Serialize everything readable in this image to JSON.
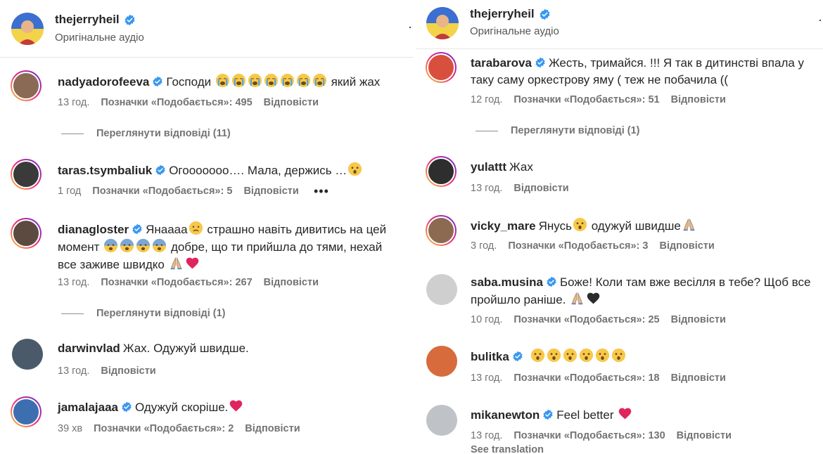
{
  "left": {
    "header": {
      "username": "thejerryheil",
      "subtitle": "Оригінальне аудіо"
    },
    "comments": [
      {
        "user": "nadyadorofeeva",
        "text": "Господи",
        "emoji_after": "😭😭😭😭😭😭😭",
        "text2": "який жах",
        "time": "13 год.",
        "likes": "Позначки «Подобається»: 495",
        "reply": "Відповісти",
        "view_replies": "Переглянути відповіді (11)"
      },
      {
        "user": "taras.tsymbaliuk",
        "text": "Огооооооо…. Мала, держись …",
        "emoji_after": "😮",
        "time": "1 год",
        "likes": "Позначки «Подобається»: 5",
        "reply": "Відповісти",
        "more": "•••"
      },
      {
        "user": "dianagloster",
        "line1": "Янаааа",
        "line1b": "страшно навіть дивитись на цей",
        "line2a": "момент",
        "line2b": "добре, що ти прийшла до тями, нехай",
        "line3": "все заживе швидко",
        "time": "13 год.",
        "likes": "Позначки «Подобається»: 267",
        "reply": "Відповісти",
        "view_replies": "Переглянути відповіді (1)"
      },
      {
        "user": "darwinvlad",
        "text": "Жах. Одужуй швидше.",
        "time": "13 год.",
        "reply": "Відповісти"
      },
      {
        "user": "jamalajaaa",
        "text": "Одужуй скоріше.",
        "time": "39 хв",
        "likes": "Позначки «Подобається»: 2",
        "reply": "Відповісти"
      }
    ]
  },
  "right": {
    "header": {
      "username": "thejerryheil",
      "subtitle": "Оригінальне аудіо"
    },
    "comments": [
      {
        "user": "tarabarova",
        "line1": "Жесть, тримайся. !!! Я так в дитинстві впала у",
        "line2": "таку саму оркестрову яму ( теж не побачила ((",
        "time": "12 год.",
        "likes": "Позначки «Подобається»: 51",
        "reply": "Відповісти",
        "view_replies": "Переглянути відповіді (1)"
      },
      {
        "user": "yulattt",
        "text": "Жах",
        "time": "13 год.",
        "reply": "Відповісти"
      },
      {
        "user": "vicky_mare",
        "text": "Янусь",
        "text2": "одужуй швидше",
        "time": "3 год.",
        "likes": "Позначки «Подобається»: 3",
        "reply": "Відповісти"
      },
      {
        "user": "saba.musina",
        "line1": "Боже! Коли там вже весілля в тебе? Щоб все",
        "line2": "пройшло раніше.",
        "time": "10 год.",
        "likes": "Позначки «Подобається»: 25",
        "reply": "Відповісти"
      },
      {
        "user": "bulitka",
        "time": "13 год.",
        "likes": "Позначки «Подобається»: 18",
        "reply": "Відповісти"
      },
      {
        "user": "mikanewton",
        "text": "Feel better",
        "time": "13 год.",
        "likes": "Позначки «Подобається»: 130",
        "reply": "Відповісти",
        "see_translation": "See translation"
      }
    ]
  }
}
